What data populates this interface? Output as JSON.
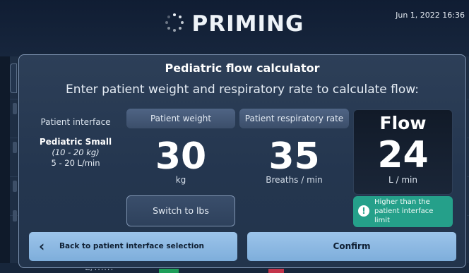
{
  "header": {
    "title": "PRIMING",
    "date": "Jun 1, 2022 16:36"
  },
  "background": {
    "bottom_text": "L/min",
    "bottom_percent": "%"
  },
  "modal": {
    "title": "Pediatric flow calculator",
    "subtitle": "Enter patient weight and respiratory rate to calculate flow:",
    "patient_interface": {
      "label": "Patient interface",
      "name": "Pediatric Small",
      "range": "(10 - 20 kg)",
      "flow_range": "5 - 20 L/min"
    },
    "weight": {
      "label": "Patient weight",
      "value": "30",
      "unit": "kg"
    },
    "resp_rate": {
      "label": "Patient respiratory rate",
      "value": "35",
      "unit": "Breaths / min"
    },
    "flow": {
      "label": "Flow",
      "value": "24",
      "unit": "L / min"
    },
    "switch_label": "Switch to lbs",
    "warning": {
      "icon": "exclamation-icon",
      "text": "Higher than the patient interface limit",
      "color": "#25a08a"
    },
    "back_label": "Back to patient interface selection",
    "confirm_label": "Confirm"
  }
}
